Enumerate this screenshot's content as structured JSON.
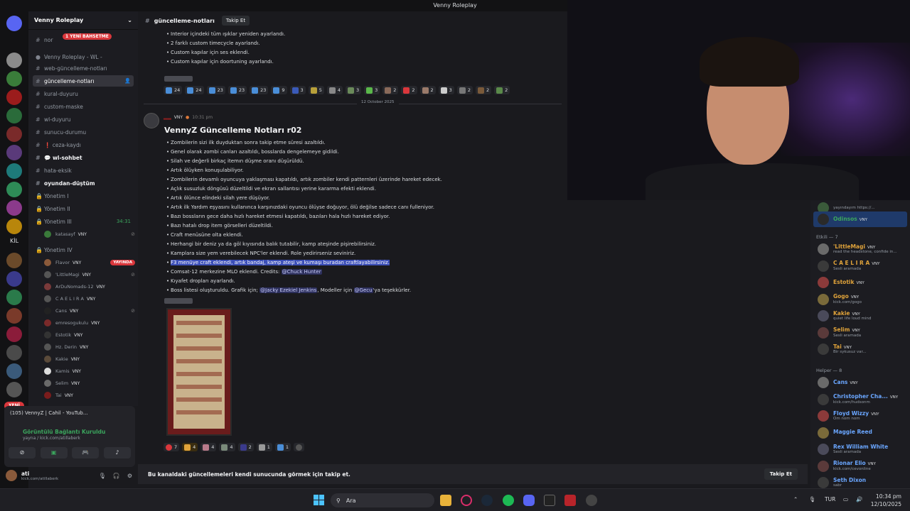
{
  "window_title": "Venny Roleplay",
  "guild": {
    "name": "Venny Roleplay"
  },
  "channels": {
    "new_badge": "1 YENİ BAHSETME",
    "items": [
      {
        "label": "nor"
      },
      {
        "label": "Venny Roleplay - WL -"
      },
      {
        "label": "web-güncelleme-notları"
      },
      {
        "label": "güncelleme-notları"
      },
      {
        "label": "kural-duyuru"
      },
      {
        "label": "custom-maske"
      },
      {
        "label": "wl-duyuru"
      },
      {
        "label": "sunucu-durumu"
      },
      {
        "label": "❗ ceza-kaydı"
      },
      {
        "label": "💬 wl-sohbet"
      },
      {
        "label": "hata-eksik"
      },
      {
        "label": "oyundan-düştüm"
      },
      {
        "label": "Yönetim I"
      },
      {
        "label": "Yönetim II"
      },
      {
        "label": "Yönetim III",
        "tail": "34:31"
      },
      {
        "label": "Yönetim IV"
      }
    ],
    "voice_y3": [
      {
        "name": "katasayf",
        "tag": "VNY"
      }
    ],
    "voice_y4": [
      {
        "name": "Flavor",
        "tag": "VNY",
        "live": "YAYINDA"
      },
      {
        "name": "'LittleMagi",
        "tag": "VNY"
      },
      {
        "name": "ArDuNomads-12",
        "tag": "VNY"
      },
      {
        "name": "C A E L I R A",
        "tag": "VNY"
      },
      {
        "name": "Cans",
        "tag": "VNY"
      },
      {
        "name": "emresogukulu",
        "tag": "VNY"
      },
      {
        "name": "Estotik",
        "tag": "VNY"
      },
      {
        "name": "Hz. Derin",
        "tag": "VNY"
      },
      {
        "name": "Kakie",
        "tag": "VNY"
      },
      {
        "name": "Kamis",
        "tag": "VNY"
      },
      {
        "name": "Selim",
        "tag": "VNY"
      },
      {
        "name": "Tai",
        "tag": "VNY"
      }
    ]
  },
  "rail": {
    "kil_label": "KİL",
    "new_label": "YENİ",
    "badge_305": "305"
  },
  "voice_panel": {
    "stream_title": "(105) VennyZ | Cahil - YouTub...",
    "connected": "Görüntülü Bağlantı Kuruldu",
    "connected_sub": "yayna / kick.com/atillaberk"
  },
  "user": {
    "name": "ati",
    "sub": "kick.com/atillaberk"
  },
  "chat_header": {
    "channel": "güncelleme-notları",
    "follow": "Takip Et"
  },
  "prev_message": {
    "bullets": [
      "Interior içindeki tüm ışıklar yeniden ayarlandı.",
      "2 farklı custom timecycle ayarlandı.",
      "Custom kapılar için ses eklendi.",
      "Custom kapılar için doortuning ayarlandı."
    ],
    "reactions": [
      "24",
      "24",
      "23",
      "23",
      "23",
      "9",
      "3",
      "5",
      "4",
      "3",
      "3",
      "2",
      "2",
      "2",
      "3",
      "2",
      "2",
      "2"
    ]
  },
  "date_separator": "12 October 2025",
  "message": {
    "author_tag": "VNY",
    "time": "10:31 pm",
    "title": "VennyZ Güncelleme Notları r02",
    "bullets": [
      "Zombilerin sizi ilk duyduktan sonra takip etme süresi azaltıldı.",
      "Genel olarak zombi canları azaltıldı, bosslarda dengelemeye gidildi.",
      "Silah ve değerli birkaç itemın düşme oranı düşürüldü.",
      "Artık ölüyken konuşulabiliyor.",
      "Zombilerin devamlı oyuncuya yaklaşması kapatıldı, artık zombiler kendi patternleri üzerinde hareket edecek.",
      "Açlık susuzluk döngüsü düzeltildi ve ekran sallantısı yerine kararma efekti eklendi.",
      "Artık ölünce elindeki silah yere düşüyor.",
      "Artık ilk Yardım eşyasını kullanınca karşınızdaki oyuncu ölüyse doğuyor, ölü değilse sadece canı fulleniyor.",
      "Bazı bossların gece daha hızlı hareket etmesi kapatıldı, bazıları hala hızlı hareket ediyor.",
      "Bazı hatalı drop item görselleri düzeltildi.",
      "Craft menüsüne olta eklendi.",
      "Herhangi bir deniz ya da göl kıyısında balık tutabilir, kamp ateşinde pişirebilirsiniz.",
      "Kamplara size yem verebilecek NPC'ler eklendi. Role yedirirseniz seviniriz."
    ],
    "highlighted": "F3 menüye craft eklendi, artık bandaj, kamp ateşi ve kumaşı buradan craftlayabilirsiniz.",
    "comsat_text": "Comsat-12 merkezine MLO eklendi. Credits: ",
    "comsat_mention": "@Chuck Hunter",
    "kiyafet": "Kıyafet dropları ayarlandı.",
    "boss_a": "Boss listesi oluşturuldu. Grafik için; ",
    "boss_m1": "@Jacky Ezekiel Jenkins",
    "boss_b": ", Modeller için ",
    "boss_m2": "@Gecu",
    "boss_c": "'ya teşekkürler.",
    "reactions": [
      "7",
      "4",
      "4",
      "4",
      "2",
      "1",
      "1"
    ]
  },
  "follow_bar": {
    "text": "Bu kanaldaki güncellemeleri kendi sunucunda görmek için takip et.",
    "button": "Takip Et"
  },
  "members": {
    "top_partial": {
      "name": "Odinsos",
      "tag": "VNY",
      "status_above": "yayındayım https://..."
    },
    "etkili_header": "Etkili — 7",
    "etkili": [
      {
        "name": "'LittleMagi",
        "tag": "VNY",
        "status": "read the headstone, confide in...",
        "color": "#e0a33a"
      },
      {
        "name": "C A E L I R A",
        "tag": "VNY",
        "status": "Sesli aramada",
        "color": "#e0a33a"
      },
      {
        "name": "Estotik",
        "tag": "VNY",
        "status": "",
        "color": "#e0a33a"
      },
      {
        "name": "Gogo",
        "tag": "VNY",
        "status": "kick.com/gogo",
        "color": "#e0a33a"
      },
      {
        "name": "Kakie",
        "tag": "VNY",
        "status": "quiet life loud mind",
        "color": "#e0a33a"
      },
      {
        "name": "Selim",
        "tag": "VNY",
        "status": "Sesli aramada",
        "color": "#e0a33a"
      },
      {
        "name": "Tai",
        "tag": "VNY",
        "status": "Bir sykusuz var...",
        "color": "#e0a33a"
      }
    ],
    "helper_header": "Helper — 8",
    "helper": [
      {
        "name": "Cans",
        "tag": "VNY",
        "status": "",
        "color": "#6aa6ff"
      },
      {
        "name": "Christopher Cha...",
        "tag": "VNY",
        "status": "kick.com/hudsonm",
        "color": "#6aa6ff"
      },
      {
        "name": "Floyd Wizzy",
        "tag": "VNY",
        "status": "Om nom nom",
        "color": "#6aa6ff"
      },
      {
        "name": "Maggie Reed",
        "tag": "",
        "status": "",
        "color": "#6aa6ff"
      },
      {
        "name": "Rex William White",
        "tag": "",
        "status": "Sesli aramada",
        "color": "#6aa6ff"
      },
      {
        "name": "Rionar Elio",
        "tag": "VNY",
        "status": "kick.com/cevonline",
        "color": "#6aa6ff"
      },
      {
        "name": "Seth Dixon",
        "tag": "",
        "status": "sabr",
        "color": "#6aa6ff"
      }
    ]
  },
  "taskbar": {
    "search_placeholder": "Ara",
    "lang": "TUR",
    "time": "10:34 pm",
    "date": "12/10/2025"
  },
  "colors": {
    "accent": "#5865f2",
    "highlight": "#3c4fb8",
    "danger": "#da373c",
    "online": "#3ba55d"
  }
}
